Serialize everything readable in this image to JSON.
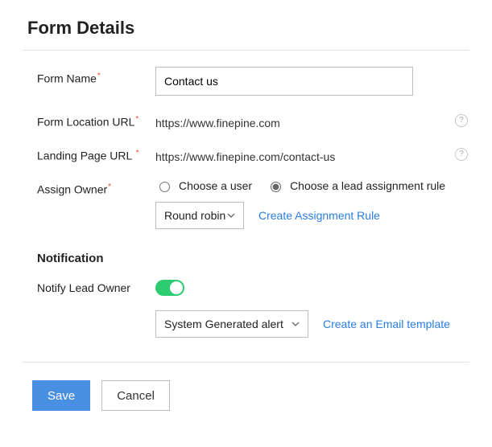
{
  "title": "Form Details",
  "fields": {
    "formName": {
      "label": "Form Name",
      "value": "Contact us",
      "required": true
    },
    "formLocation": {
      "label": "Form Location URL",
      "value": "https://www.finepine.com",
      "required": true
    },
    "landingPage": {
      "label": "Landing Page URL",
      "value": "https://www.finepine.com/contact-us",
      "required": true
    },
    "assignOwner": {
      "label": "Assign Owner",
      "required": true,
      "radios": {
        "chooseUser": "Choose a user",
        "chooseRule": "Choose a lead assignment rule"
      },
      "ruleSelect": "Round robin",
      "createRule": "Create Assignment Rule"
    }
  },
  "notification": {
    "heading": "Notification",
    "notifyOwner": {
      "label": "Notify Lead Owner",
      "enabled": true
    },
    "alertSelect": "System Generated alert",
    "createTemplate": "Create an Email template"
  },
  "buttons": {
    "save": "Save",
    "cancel": "Cancel"
  },
  "symbols": {
    "required": "*",
    "help": "?"
  }
}
